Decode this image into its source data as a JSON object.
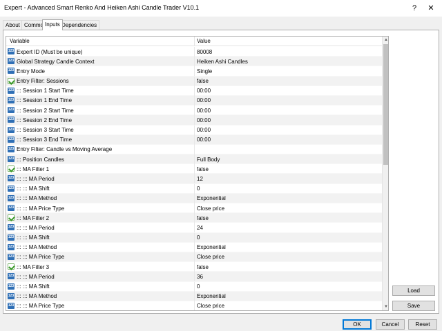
{
  "window": {
    "title": "Expert - Advanced Smart Renko And Heiken Ashi Candle Trader V10.1",
    "help_glyph": "?",
    "close_glyph": "✕"
  },
  "tabs": [
    {
      "label": "About"
    },
    {
      "label": "Common"
    },
    {
      "label": "Inputs",
      "active": true
    },
    {
      "label": "Dependencies"
    }
  ],
  "grid": {
    "columns": {
      "variable": "Variable",
      "value": "Value"
    },
    "rows": [
      {
        "icon": "num-icon",
        "variable": "Expert ID (Must be unique)",
        "value": "80008"
      },
      {
        "icon": "num-icon",
        "variable": "Global Strategy Candle Context",
        "value": "Heiken Ashi Candles"
      },
      {
        "icon": "num-icon",
        "variable": "Entry Mode",
        "value": "Single"
      },
      {
        "icon": "bool-icon",
        "variable": "Entry Filter: Sessions",
        "value": "false"
      },
      {
        "icon": "num-icon",
        "variable": "::: Session 1 Start Time",
        "value": "00:00"
      },
      {
        "icon": "num-icon",
        "variable": "::: Session 1 End Time",
        "value": "00:00"
      },
      {
        "icon": "num-icon",
        "variable": "::: Session 2 Start Time",
        "value": "00:00"
      },
      {
        "icon": "num-icon",
        "variable": "::: Session 2 End Time",
        "value": "00:00"
      },
      {
        "icon": "num-icon",
        "variable": "::: Session 3 Start Time",
        "value": "00:00"
      },
      {
        "icon": "num-icon",
        "variable": "::: Session 3 End Time",
        "value": "00:00"
      },
      {
        "icon": "num-icon",
        "variable": "Entry Filter: Candle vs Moving Average",
        "value": ""
      },
      {
        "icon": "num-icon",
        "variable": "::: Position Candles",
        "value": "Full Body"
      },
      {
        "icon": "bool-icon",
        "variable": "::: MA Filter 1",
        "value": "false"
      },
      {
        "icon": "num-icon",
        "variable": "::: ::: MA Period",
        "value": "12"
      },
      {
        "icon": "num-icon",
        "variable": "::: ::: MA Shift",
        "value": "0"
      },
      {
        "icon": "num-icon",
        "variable": "::: ::: MA Method",
        "value": "Exponential"
      },
      {
        "icon": "num-icon",
        "variable": "::: ::: MA Price Type",
        "value": "Close price"
      },
      {
        "icon": "bool-icon",
        "variable": "::: MA Filter 2",
        "value": "false"
      },
      {
        "icon": "num-icon",
        "variable": "::: ::: MA Period",
        "value": "24"
      },
      {
        "icon": "num-icon",
        "variable": "::: ::: MA Shift",
        "value": "0"
      },
      {
        "icon": "num-icon",
        "variable": "::: ::: MA Method",
        "value": "Exponential"
      },
      {
        "icon": "num-icon",
        "variable": "::: ::: MA Price Type",
        "value": "Close price"
      },
      {
        "icon": "bool-icon",
        "variable": "::: MA Filter 3",
        "value": "false"
      },
      {
        "icon": "num-icon",
        "variable": "::: ::: MA Period",
        "value": "36"
      },
      {
        "icon": "num-icon",
        "variable": "::: ::: MA Shift",
        "value": "0"
      },
      {
        "icon": "num-icon",
        "variable": "::: ::: MA Method",
        "value": "Exponential"
      },
      {
        "icon": "num-icon",
        "variable": "::: ::: MA Price Type",
        "value": "Close price"
      }
    ]
  },
  "scrollbar": {
    "up_glyph": "▲",
    "down_glyph": "▼"
  },
  "buttons": {
    "load": "Load",
    "save": "Save",
    "ok": "OK",
    "cancel": "Cancel",
    "reset": "Reset"
  },
  "colors": {
    "num_icon": "#2f6fb5",
    "bool_icon": "#3a9a2a",
    "ok_border": "#0078d7"
  }
}
